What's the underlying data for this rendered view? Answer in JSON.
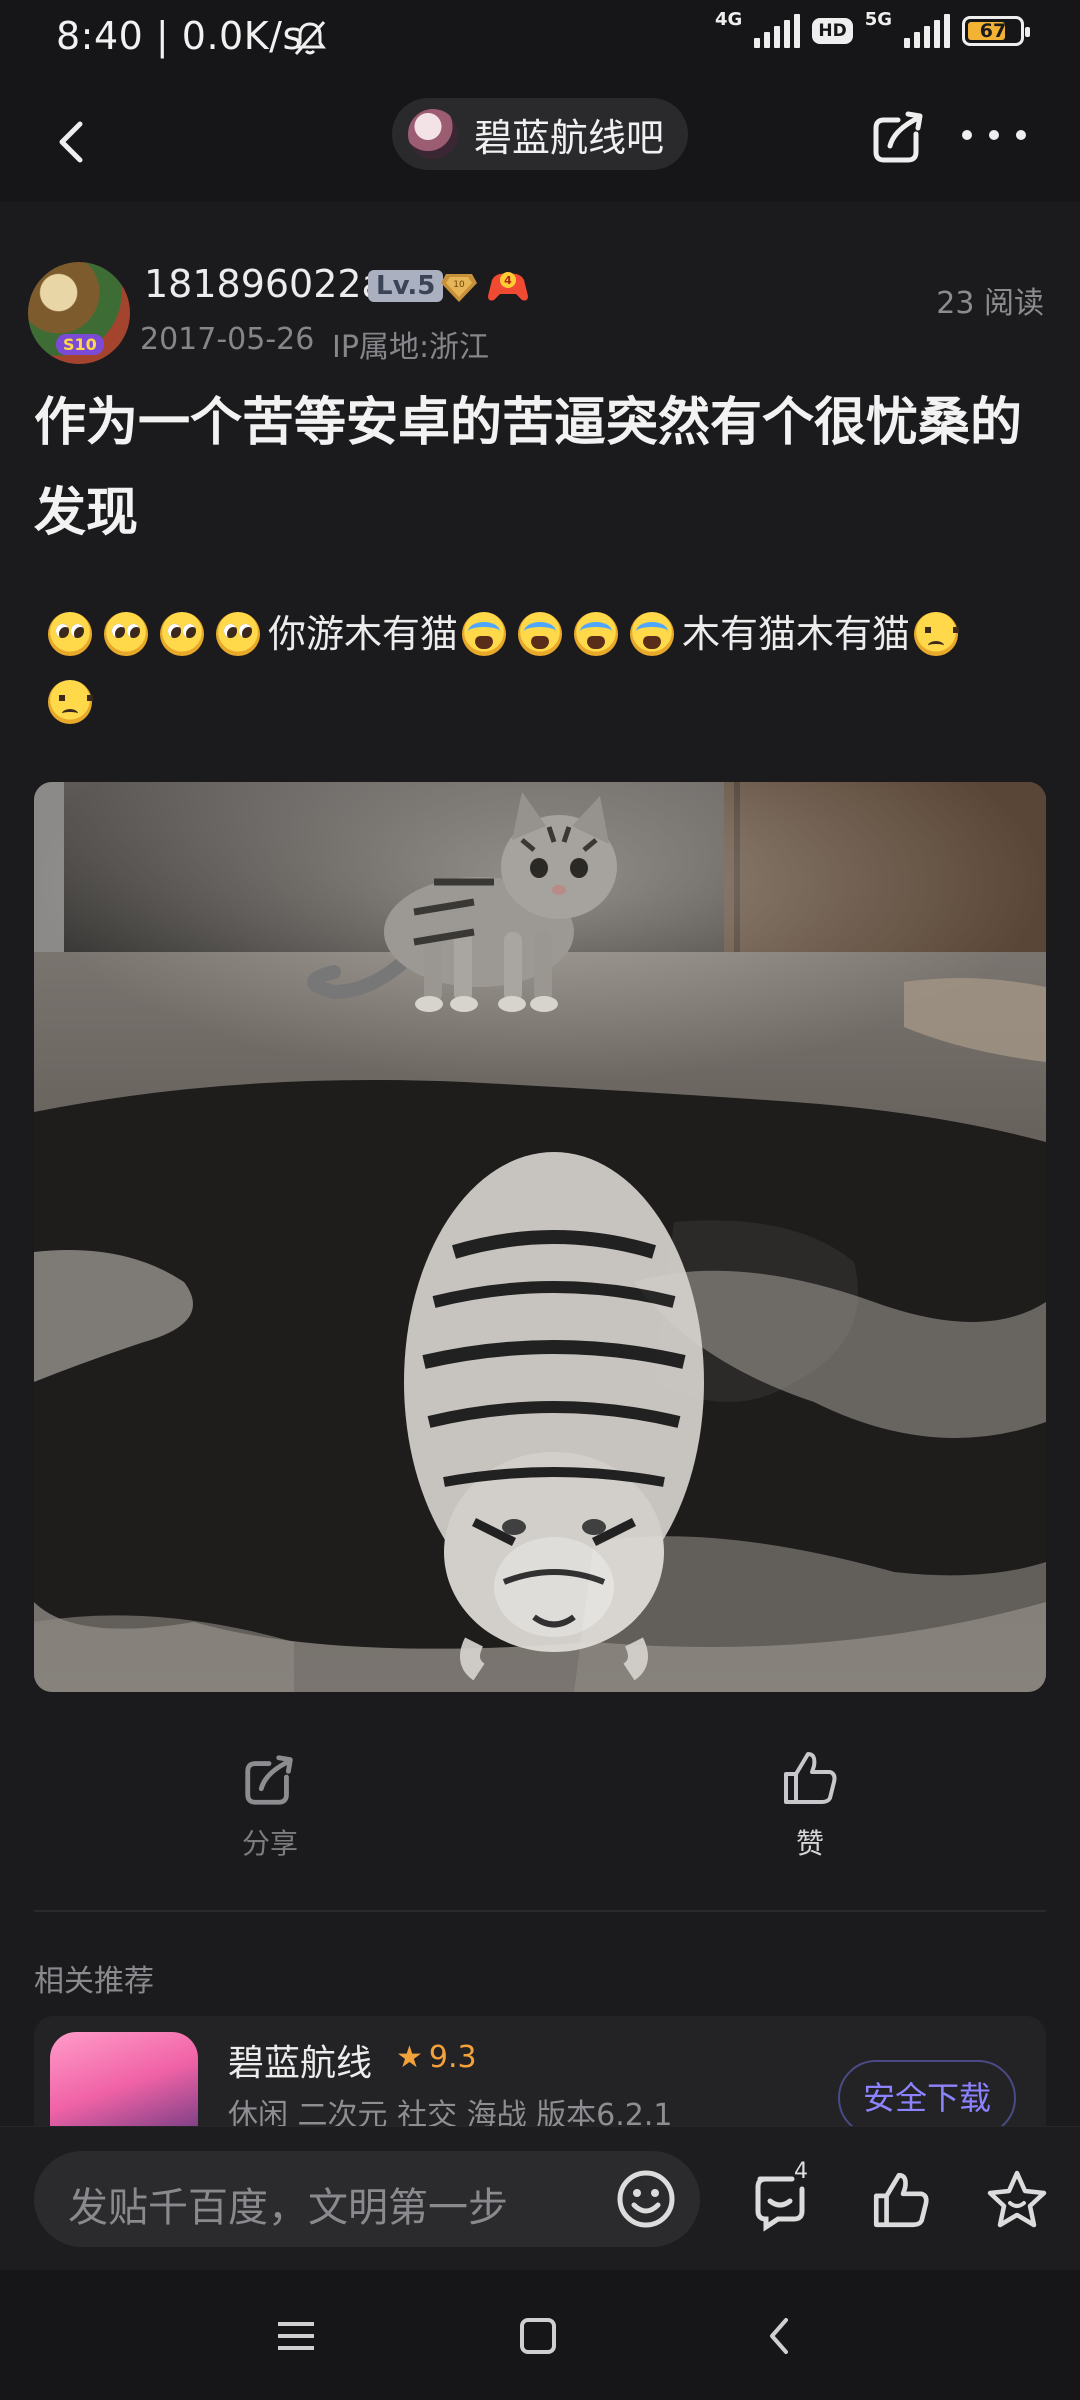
{
  "status_bar": {
    "time": "8:40 | 0.0K/s",
    "net1": "4G",
    "hd": "HD",
    "net2": "5G",
    "battery": "67"
  },
  "nav": {
    "forum_name": "碧蓝航线吧"
  },
  "post": {
    "username": "181896022a",
    "level": "Lv.5",
    "medal_value": "10",
    "medal_num": "4",
    "avatar_badge": "S10",
    "read_count": "23 阅读",
    "date": "2017-05-26",
    "ip": "IP属地:浙江",
    "title": "作为一个苦等安卓的苦逼突然有个很忧桑的发现",
    "body_text1": "你游木有猫",
    "body_text2": "木有猫木有猫"
  },
  "actions": {
    "share_label": "分享",
    "like_label": "赞"
  },
  "recommend": {
    "title": "相关推荐",
    "app_name": "碧蓝航线",
    "rating": "9.3",
    "tags": "休闲 二次元 社交 海战   版本6.2.1",
    "download": "安全下载"
  },
  "bottom_bar": {
    "placeholder": "发贴千百度，文明第一步",
    "comment_count": "4"
  }
}
